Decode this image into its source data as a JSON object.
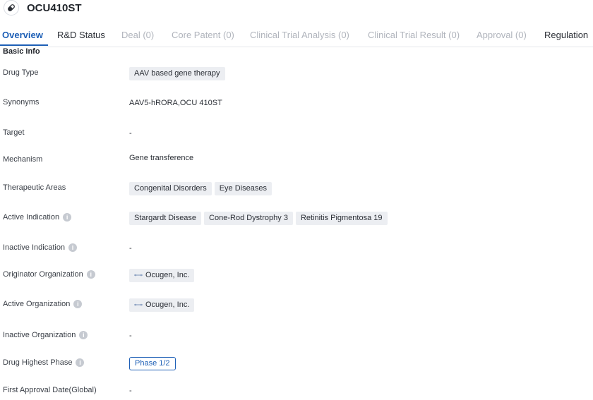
{
  "header": {
    "title": "OCU410ST",
    "icon": "pill-icon"
  },
  "tabs": [
    {
      "label": "Overview",
      "state": "active"
    },
    {
      "label": "R&D Status",
      "state": "normal"
    },
    {
      "label": "Deal (0)",
      "state": "disabled"
    },
    {
      "label": "Core Patent (0)",
      "state": "disabled"
    },
    {
      "label": "Clinical Trial Analysis (0)",
      "state": "disabled"
    },
    {
      "label": "Clinical Trial Result (0)",
      "state": "disabled"
    },
    {
      "label": "Approval (0)",
      "state": "disabled"
    },
    {
      "label": "Regulation",
      "state": "normal"
    }
  ],
  "basic_info": {
    "section_title": "Basic Info",
    "drug_type": {
      "label": "Drug Type",
      "tags": [
        "AAV based gene therapy"
      ]
    },
    "synonyms": {
      "label": "Synonyms",
      "value": "AAV5-hRORA,OCU 410ST"
    },
    "target": {
      "label": "Target",
      "value": "-"
    },
    "mechanism": {
      "label": "Mechanism",
      "value": "Gene transference"
    },
    "therapeutic_areas": {
      "label": "Therapeutic Areas",
      "tags": [
        "Congenital Disorders",
        "Eye Diseases"
      ]
    },
    "active_indication": {
      "label": "Active Indication",
      "tags": [
        "Stargardt Disease",
        "Cone-Rod Dystrophy 3",
        "Retinitis Pigmentosa 19"
      ]
    },
    "inactive_indication": {
      "label": "Inactive Indication",
      "value": "-"
    },
    "originator_organization": {
      "label": "Originator Organization",
      "org": "Ocugen, Inc."
    },
    "active_organization": {
      "label": "Active Organization",
      "org": "Ocugen, Inc."
    },
    "inactive_organization": {
      "label": "Inactive Organization",
      "value": "-"
    },
    "drug_highest_phase": {
      "label": "Drug Highest Phase",
      "phase": "Phase 1/2"
    },
    "first_approval_date": {
      "label": "First Approval Date(Global)",
      "value": "-"
    }
  },
  "colors": {
    "accent": "#1d5fb6",
    "tag_bg": "#eceef2",
    "disabled_text": "#b0b4bc"
  }
}
